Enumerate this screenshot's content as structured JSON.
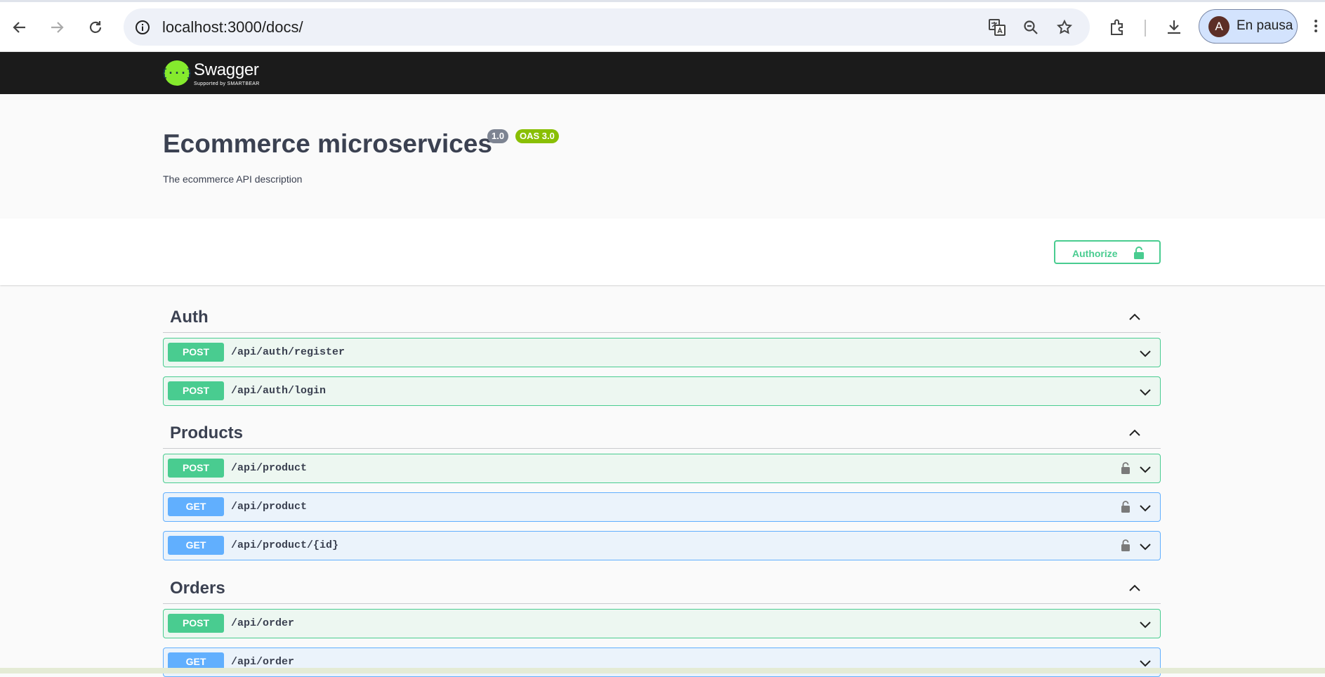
{
  "browser": {
    "url": "localhost:3000/docs/",
    "profile_initial": "A",
    "profile_status": "En pausa"
  },
  "swagger": {
    "brand": "Swagger",
    "sub": "Supported by SMARTBEAR"
  },
  "info": {
    "title": "Ecommerce microservices",
    "version": "1.0",
    "oas": "OAS 3.0",
    "description": "The ecommerce API description"
  },
  "auth_button": {
    "label": "Authorize"
  },
  "tags": [
    {
      "name": "Auth",
      "operations": [
        {
          "method": "POST",
          "path": "/api/auth/register"
        },
        {
          "method": "POST",
          "path": "/api/auth/login"
        }
      ]
    },
    {
      "name": "Products",
      "operations": [
        {
          "method": "POST",
          "path": "/api/product"
        },
        {
          "method": "GET",
          "path": "/api/product"
        },
        {
          "method": "GET",
          "path": "/api/product/{id}"
        }
      ]
    },
    {
      "name": "Orders",
      "operations": [
        {
          "method": "POST",
          "path": "/api/order"
        },
        {
          "method": "GET",
          "path": "/api/order"
        }
      ]
    }
  ],
  "colors": {
    "post": "#49cc90",
    "get": "#61affe",
    "topbar": "#1b1b1b",
    "swagger_green": "#85ea2d"
  }
}
